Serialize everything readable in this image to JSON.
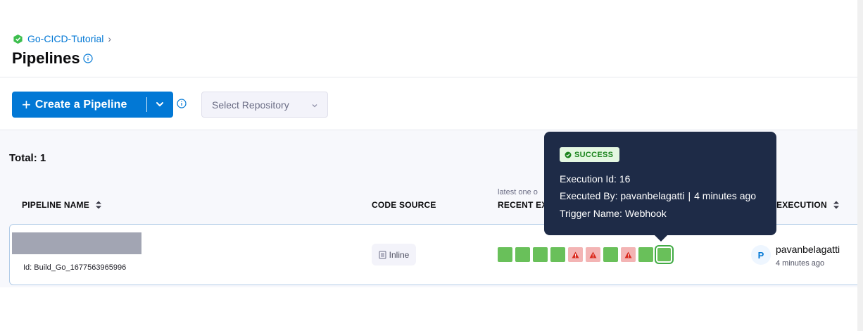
{
  "breadcrumb": {
    "project": "Go-CICD-Tutorial",
    "separator": "›"
  },
  "page": {
    "title": "Pipelines"
  },
  "toolbar": {
    "create_label": "Create a Pipeline",
    "create_plus": "+",
    "repo_placeholder": "Select Repository"
  },
  "summary": {
    "total": "Total: 1"
  },
  "table": {
    "columns": {
      "pipeline_name": "PIPELINE NAME",
      "code_source": "CODE SOURCE",
      "recent_sub": "latest one o",
      "recent": "RECENT EX",
      "last_execution": "EXECUTION"
    },
    "rows": [
      {
        "id": "Id: Build_Go_1677563965996",
        "code_source": "Inline",
        "executions": [
          "success",
          "success",
          "success",
          "success",
          "failed",
          "failed",
          "success",
          "failed",
          "success",
          "success"
        ],
        "user_avatar": "P",
        "user_name": "pavanbelagatti",
        "user_time": "4 minutes ago"
      }
    ]
  },
  "tooltip": {
    "status": "SUCCESS",
    "execution_id": "Execution Id: 16",
    "executed_by_label": "Executed By:",
    "executed_by_user": "pavanbelagatti",
    "executed_by_time": "4 minutes ago",
    "trigger_label": "Trigger Name:",
    "trigger_name": "Webhook"
  },
  "colors": {
    "primary": "#0278d5",
    "success": "#69c05a",
    "failed": "#f3b4b4",
    "tooltip_bg": "#1e2b47"
  },
  "icons": [
    "project-icon",
    "info-icon",
    "caret-down-icon",
    "chevron-down-icon",
    "sort-icon",
    "inline-icon",
    "warning-icon",
    "check-circle-icon"
  ]
}
